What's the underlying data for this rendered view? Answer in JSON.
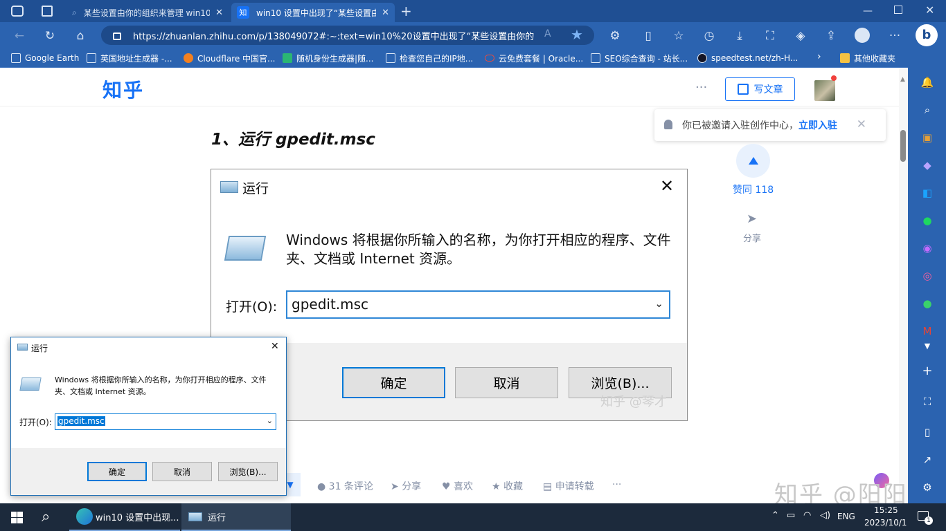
{
  "browser": {
    "tabs": [
      {
        "title": "某些设置由你的组织来管理 win10",
        "favicon": "search-icon",
        "active": false
      },
      {
        "title": "win10 设置中出现了“某些设置由",
        "favicon": "知",
        "active": true
      }
    ],
    "new_tab": "+",
    "url": "https://zhuanlan.zhihu.com/p/138049072#:~:text=win10%20设置中出现了“某些设置由你的...",
    "favorites": [
      "Google Earth",
      "英国地址生成器 -...",
      "Cloudflare 中国官...",
      "随机身份生成器|随...",
      "检查您自己的IP地...",
      "云免费套餐 | Oracle...",
      "SEO综合查询 - 站长...",
      "speedtest.net/zh-H...",
      "其他收藏夹"
    ]
  },
  "zhihu": {
    "logo": "知乎",
    "more": "···",
    "write_button": "写文章",
    "invite_text": "你已被邀请入驻创作中心，",
    "invite_link": "立即入驻",
    "heading": "1、运行 gpedit.msc",
    "upvote": "赞同 118",
    "share_side": "分享",
    "engagement": {
      "comments": "31 条评论",
      "share": "分享",
      "like": "喜欢",
      "collect": "收藏",
      "repost": "申请转载",
      "more": "···"
    },
    "watermark": "知乎 @阳阳"
  },
  "article_image": {
    "title": "运行",
    "description": "Windows 将根据你所输入的名称，为你打开相应的程序、文件夹、文档或 Internet 资源。",
    "open_label": "打开(O):",
    "value": "gpedit.msc",
    "ok": "确定",
    "cancel": "取消",
    "browse": "浏览(B)...",
    "watermark": "知乎 @琴才"
  },
  "run_dialog": {
    "title": "运行",
    "description": "Windows 将根据你所输入的名称，为你打开相应的程序、文件夹、文档或 Internet 资源。",
    "open_label": "打开(O):",
    "value": "gpedit.msc",
    "ok": "确定",
    "cancel": "取消",
    "browse": "浏览(B)..."
  },
  "taskbar": {
    "apps": [
      {
        "label": "win10 设置中出现...",
        "icon": "edge-icon"
      },
      {
        "label": "运行",
        "icon": "run-icon"
      }
    ],
    "lang": "ENG",
    "time": "15:25",
    "date": "2023/10/1",
    "notifications": "1"
  },
  "colors": {
    "browser_blue": "#2b63b0",
    "zhihu_blue": "#1772f6",
    "taskbar": "#1c2a3c"
  }
}
